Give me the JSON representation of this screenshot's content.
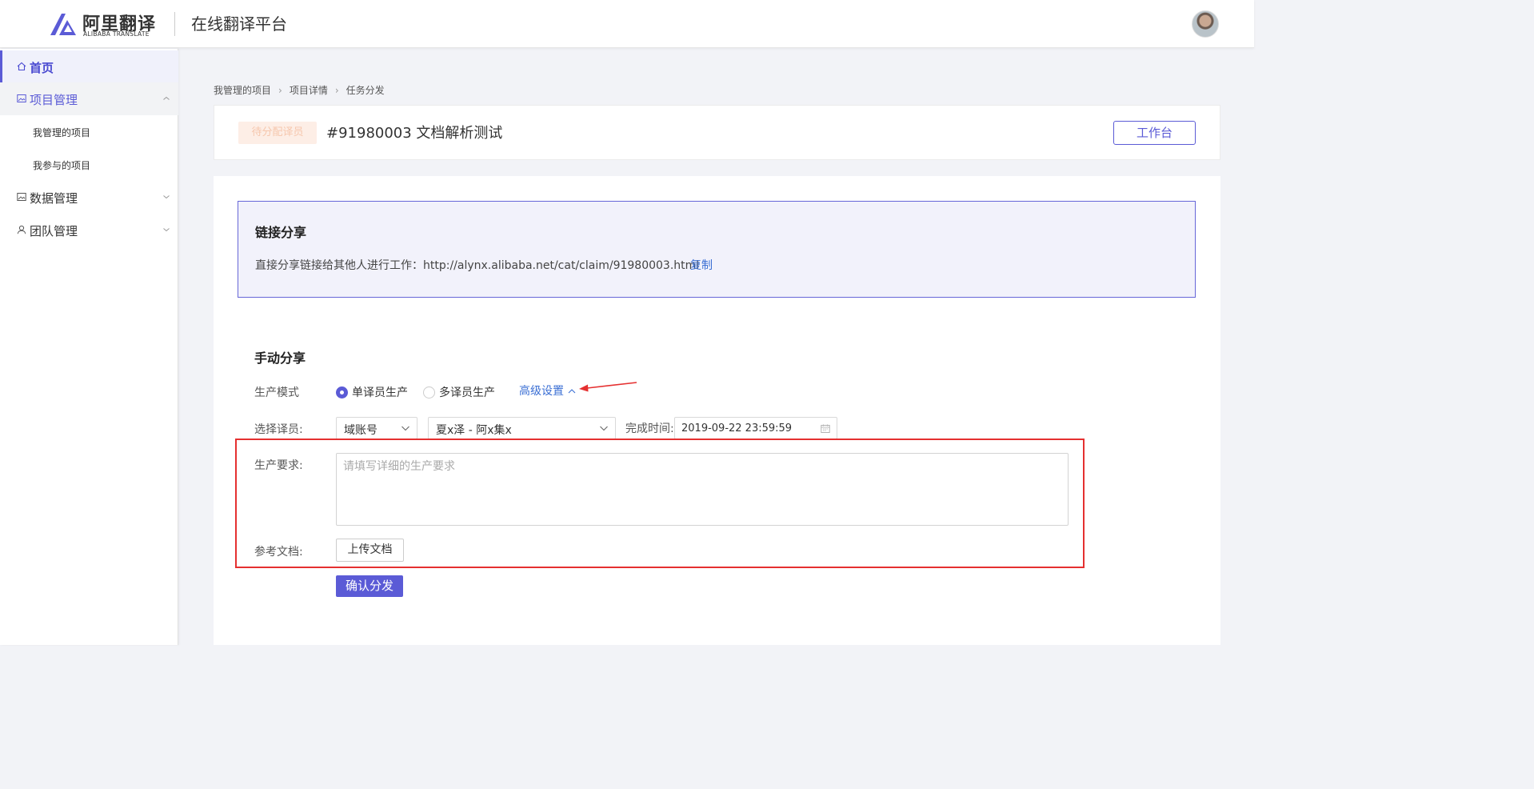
{
  "header": {
    "logo_text": "阿里翻译",
    "logo_subtext": "ALIBABA TRANSLATE",
    "platform_title": "在线翻译平台",
    "logo_icon": "alibaba-translate-logo",
    "avatar_icon": "user-avatar"
  },
  "sidebar": {
    "home_label": "首页",
    "home_icon": "home-icon",
    "project_label": "项目管理",
    "project_icon": "image-icon",
    "project_sub": [
      "我管理的项目",
      "我参与的项目"
    ],
    "data_label": "数据管理",
    "data_icon": "image-icon",
    "team_label": "团队管理",
    "team_icon": "user-icon"
  },
  "breadcrumb": [
    "我管理的项目",
    "项目详情",
    "任务分发"
  ],
  "project": {
    "status": "待分配译员",
    "title": "#91980003 文档解析测试",
    "workbench_label": "工作台"
  },
  "link_share": {
    "title": "链接分享",
    "description": "直接分享链接给其他人进行工作：http://alynx.alibaba.net/cat/claim/91980003.html",
    "copy_label": "复制"
  },
  "manual_share": {
    "title": "手动分享",
    "mode_label": "生产模式",
    "mode_options": [
      "单译员生产",
      "多译员生产"
    ],
    "mode_selected": "单译员生产",
    "advanced_label": "高级设置",
    "translator_label": "选择译员:",
    "account_type": "域账号",
    "translator_value": "夏x泽 - 阿x集x",
    "deadline_label": "完成时间:",
    "deadline_value": "2019-09-22 23:59:59",
    "requirement_label": "生产要求:",
    "requirement_placeholder": "请填写详细的生产要求",
    "requirement_value": "",
    "reference_label": "参考文档:",
    "upload_label": "上传文档",
    "confirm_label": "确认分发"
  },
  "colors": {
    "primary": "#5b5bd6",
    "link": "#3b6fd4",
    "annotation_red": "#e53030",
    "status_bg": "#fdeee6"
  }
}
